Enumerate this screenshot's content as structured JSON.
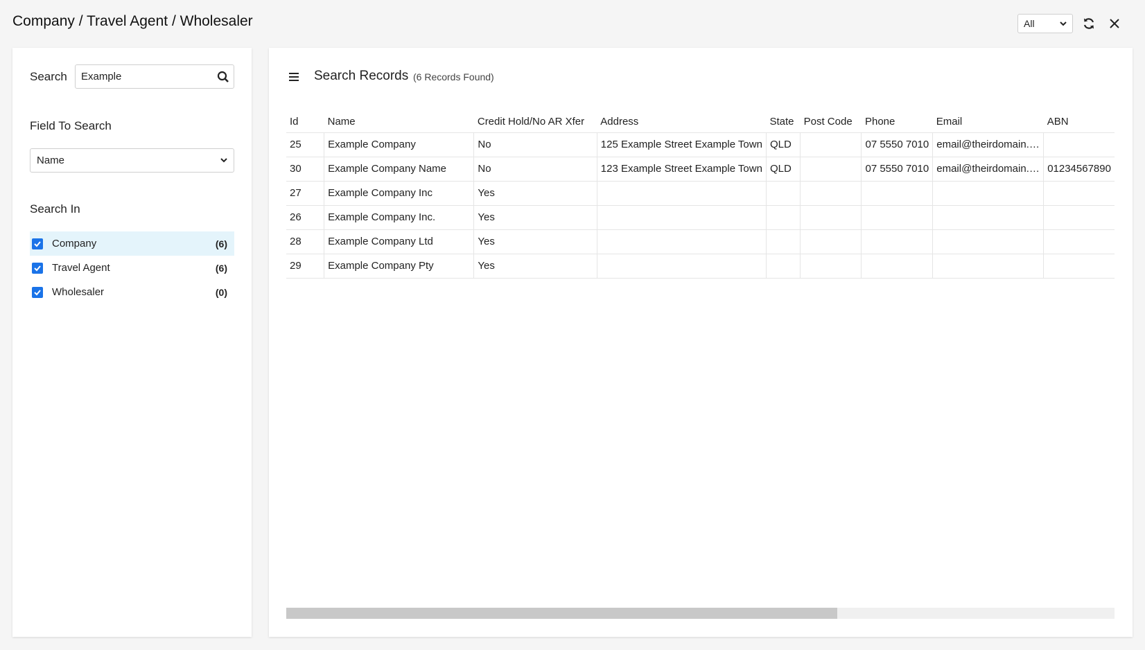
{
  "window": {
    "title": "Company / Travel Agent / Wholesaler"
  },
  "toolbar": {
    "filter_value": "All"
  },
  "search": {
    "label": "Search",
    "value": "Example"
  },
  "field_to_search": {
    "label": "Field To Search",
    "value": "Name"
  },
  "search_in": {
    "label": "Search In",
    "items": [
      {
        "label": "Company",
        "count": "(6)",
        "checked": true
      },
      {
        "label": "Travel Agent",
        "count": "(6)",
        "checked": true
      },
      {
        "label": "Wholesaler",
        "count": "(0)",
        "checked": true
      }
    ]
  },
  "results": {
    "title": "Search Records",
    "count_text": "(6 Records Found)",
    "columns": [
      "Id",
      "Name",
      "Credit Hold/No AR Xfer",
      "Address",
      "State",
      "Post Code",
      "Phone",
      "Email",
      "ABN"
    ],
    "rows": [
      [
        "25",
        "Example Company",
        "No",
        "125 Example Street Example Town",
        "QLD",
        "",
        "07 5550 7010",
        "email@theirdomain.…",
        ""
      ],
      [
        "30",
        "Example Company Name",
        "No",
        "123 Example Street Example Town",
        "QLD",
        "",
        "07 5550 7010",
        "email@theirdomain.…",
        "01234567890"
      ],
      [
        "27",
        "Example Company Inc",
        "Yes",
        "",
        "",
        "",
        "",
        "",
        ""
      ],
      [
        "26",
        "Example Company Inc.",
        "Yes",
        "",
        "",
        "",
        "",
        "",
        ""
      ],
      [
        "28",
        "Example Company Ltd",
        "Yes",
        "",
        "",
        "",
        "",
        "",
        ""
      ],
      [
        "29",
        "Example Company Pty",
        "Yes",
        "",
        "",
        "",
        "",
        "",
        ""
      ]
    ]
  }
}
